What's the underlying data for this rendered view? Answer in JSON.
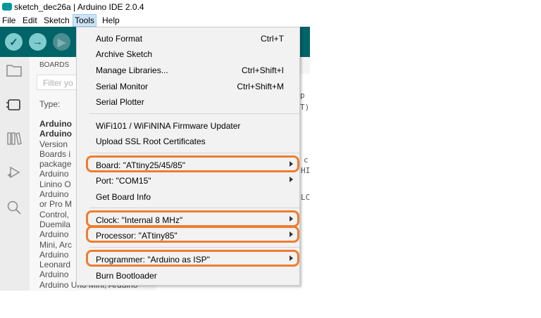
{
  "window": {
    "title": "sketch_dec26a | Arduino IDE 2.0.4"
  },
  "menubar": {
    "items": [
      "File",
      "Edit",
      "Sketch",
      "Tools",
      "Help"
    ]
  },
  "toolbar": {
    "verify_icon": "✓",
    "upload_icon": "→",
    "debug_icon": "▶"
  },
  "panel": {
    "header": "BOARDS",
    "filter_placeholder": "Filter yo",
    "type_label": "Type:",
    "lines": [
      "Arduino",
      "Arduino",
      "Version",
      "Boards i",
      "package",
      "Arduino",
      "Linino O",
      "Arduino",
      "or Pro M",
      "Control,",
      "Duemila",
      "Arduino",
      "Mini, Arc",
      "Arduino",
      "Leonard",
      "Arduino",
      "Arduino Uno Mini, Arduino"
    ]
  },
  "editor_fragments": [
    "p",
    "T)",
    "c",
    "HI",
    "LC"
  ],
  "tools_menu": {
    "items": [
      {
        "label": "Auto Format",
        "shortcut": "Ctrl+T"
      },
      {
        "label": "Archive Sketch"
      },
      {
        "label": "Manage Libraries...",
        "shortcut": "Ctrl+Shift+I"
      },
      {
        "label": "Serial Monitor",
        "shortcut": "Ctrl+Shift+M"
      },
      {
        "label": "Serial Plotter"
      },
      {
        "label": "WiFi101 / WiFiNINA Firmware Updater"
      },
      {
        "label": "Upload SSL Root Certificates"
      },
      {
        "label": "Board: \"ATtiny25/45/85\"",
        "submenu": true
      },
      {
        "label": "Port: \"COM15\"",
        "submenu": true
      },
      {
        "label": "Get Board Info"
      },
      {
        "label": "Clock: \"Internal 8 MHz\"",
        "submenu": true
      },
      {
        "label": "Processor: \"ATtiny85\"",
        "submenu": true
      },
      {
        "label": "Programmer: \"Arduino as ISP\"",
        "submenu": true
      },
      {
        "label": "Burn Bootloader"
      }
    ]
  },
  "colors": {
    "highlight": "#ed7d31",
    "toolbar": "#006468",
    "active_menu": "#cce4f7"
  }
}
